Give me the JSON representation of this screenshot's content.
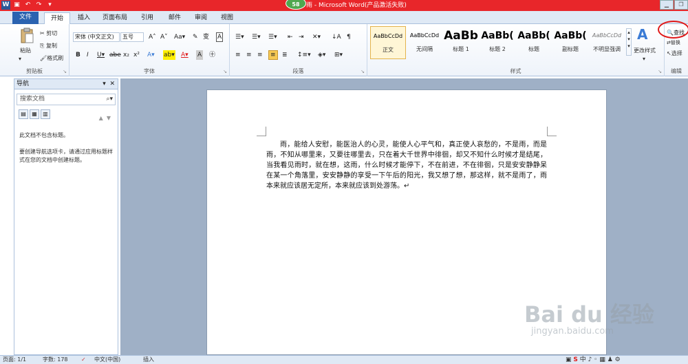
{
  "titlebar": {
    "title": "雨 - Microsoft Word(产品激活失败)",
    "badge": "58",
    "app_icon": "W"
  },
  "tabs": [
    "文件",
    "开始",
    "插入",
    "页面布局",
    "引用",
    "邮件",
    "审阅",
    "视图"
  ],
  "ribbon": {
    "clipboard": {
      "paste": "粘贴",
      "cut": "剪切",
      "copy": "复制",
      "format_painter": "格式刷",
      "label": "剪贴板"
    },
    "font": {
      "font_name": "宋体 (中文正文)",
      "font_size": "五号",
      "label": "字体"
    },
    "paragraph": {
      "label": "段落"
    },
    "styles": {
      "label": "样式",
      "items": [
        {
          "preview": "AaBbCcDd",
          "name": "正文"
        },
        {
          "preview": "AaBbCcDd",
          "name": "无间隔"
        },
        {
          "preview": "AaBb",
          "name": "标题 1"
        },
        {
          "preview": "AaBb(",
          "name": "标题 2"
        },
        {
          "preview": "AaBb(",
          "name": "标题"
        },
        {
          "preview": "AaBb(",
          "name": "副标题"
        },
        {
          "preview": "AaBbCcDd",
          "name": "不明显强调"
        }
      ],
      "change_styles": "更改样式"
    },
    "editing": {
      "find": "查找",
      "replace": "替换",
      "select": "选择",
      "label": "编辑"
    }
  },
  "nav": {
    "title": "导航",
    "search_placeholder": "搜索文档",
    "message": "此文档不包含标题。\n\n要创建导航选项卡，请通过应用标题样式在您的文档中创建标题。"
  },
  "document": {
    "text": "雨，能给人安慰，能医治人的心灵，能使人心平气和，真正使人哀愁的，不是雨，而是雨，不知从哪里来，又要往哪里去，只在着大千世界中徘徊，却又不知什么时候才是结尾，当我看见雨时，就在想，这雨，什么时候才能停下，不在前进，不在徘徊，只是安安静静呆在某一个角落里，安安静静的享受一下午后的阳光，我又想了想，那这样，就不是雨了，雨本来就应该居无定所，本来就应该到处游荡。↵"
  },
  "status": {
    "page": "页面: 1/1",
    "words": "字数: 178",
    "language": "中文(中国)",
    "mode": "插入"
  },
  "watermark": {
    "main": "Bai du 经验",
    "sub": "jingyan.baidu.com"
  }
}
